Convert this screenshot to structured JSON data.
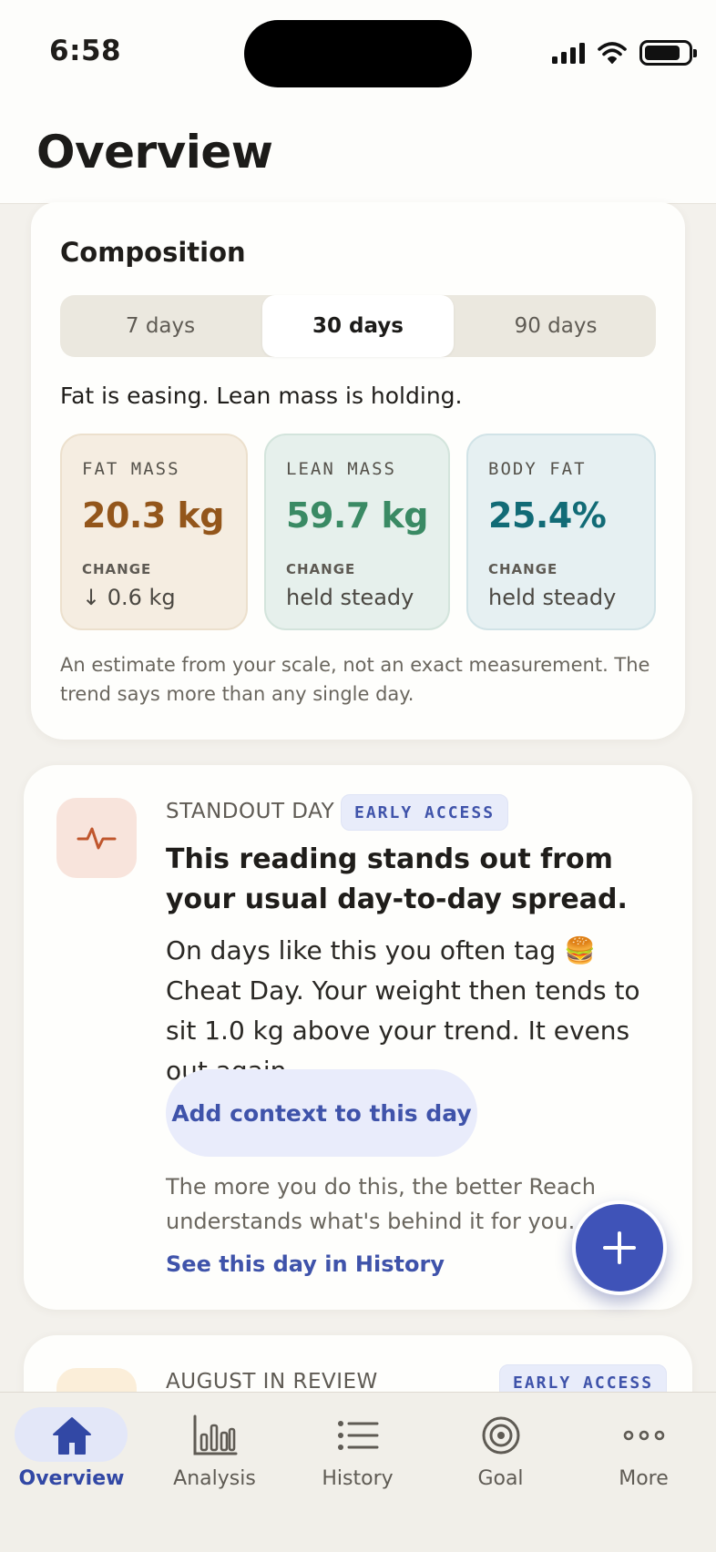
{
  "status_bar": {
    "time": "6:58"
  },
  "header": {
    "title": "Overview"
  },
  "composition": {
    "title": "Composition",
    "ranges": [
      "7 days",
      "30 days",
      "90 days"
    ],
    "selected_range": "30 days",
    "summary": "Fat is easing. Lean mass is holding.",
    "metrics": [
      {
        "label": "FAT MASS",
        "value": "20.3 kg",
        "change_label": "CHANGE",
        "change": "↓ 0.6 kg",
        "color": "#93561b"
      },
      {
        "label": "LEAN MASS",
        "value": "59.7 kg",
        "change_label": "CHANGE",
        "change": "held steady",
        "color": "#3a8a64"
      },
      {
        "label": "BODY FAT",
        "value": "25.4%",
        "change_label": "CHANGE",
        "change": "held steady",
        "color": "#126b76"
      }
    ],
    "note": "An estimate from your scale, not an exact measurement. The trend says more than any single day."
  },
  "standout": {
    "eyebrow": "STANDOUT DAY",
    "badge": "EARLY ACCESS",
    "icon": "activity-pulse-icon",
    "headline": "This reading stands out from your usual day-to-day spread.",
    "body": "On days like this you often tag 🍔 Cheat Day. Your weight then tends to sit 1.0 kg above your trend. It evens out again.",
    "button_label": "Add context to this day",
    "footnote": "The more you do this, the better Reach understands what's behind it for you.",
    "link_label": "See this day in History"
  },
  "review": {
    "eyebrow": "AUGUST IN REVIEW",
    "badge": "EARLY ACCESS"
  },
  "fab": {
    "icon": "plus-icon"
  },
  "tabs": [
    {
      "label": "Overview",
      "icon": "home-icon",
      "active": true
    },
    {
      "label": "Analysis",
      "icon": "bar-chart-icon",
      "active": false
    },
    {
      "label": "History",
      "icon": "list-icon",
      "active": false
    },
    {
      "label": "Goal",
      "icon": "target-icon",
      "active": false
    },
    {
      "label": "More",
      "icon": "more-dots-icon",
      "active": false
    }
  ],
  "colors": {
    "accent": "#3f53b8",
    "background": "#f3f1ec",
    "card": "#fefefc"
  }
}
